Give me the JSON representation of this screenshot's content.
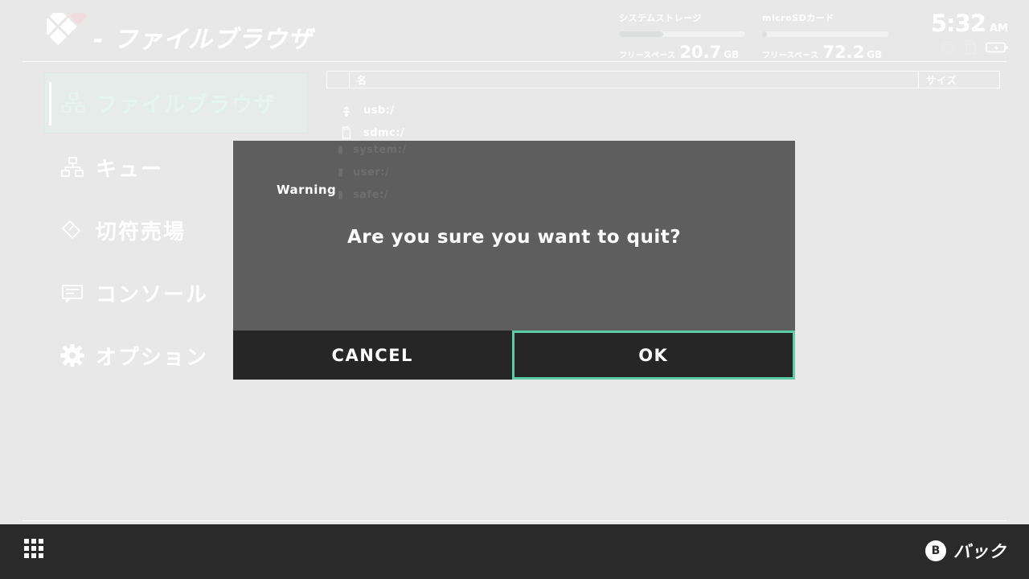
{
  "header": {
    "title": "- ファイルブラウザ",
    "logo_icon": "diamond-logo-icon",
    "storage": [
      {
        "name": "システムストレージ",
        "free_label": "フリースペース",
        "free_value": "20.7",
        "unit": "GB",
        "fill_percent": 35
      },
      {
        "name": "microSDカード",
        "free_label": "フリースペース",
        "free_value": "72.2",
        "unit": "GB",
        "fill_percent": 4
      }
    ],
    "clock": {
      "time": "5:32",
      "meridiem": "AM"
    },
    "tray_icons": [
      "wifi-icon",
      "sd-card-icon",
      "battery-charging-icon"
    ]
  },
  "sidebar": {
    "items": [
      {
        "label": "ファイルブラウザ",
        "icon": "hierarchy-icon",
        "selected": true
      },
      {
        "label": "キュー",
        "icon": "hierarchy-icon",
        "selected": false
      },
      {
        "label": "切符売場",
        "icon": "ticket-icon",
        "selected": false
      },
      {
        "label": "コンソール",
        "icon": "console-icon",
        "selected": false
      },
      {
        "label": "オプション",
        "icon": "gear-icon",
        "selected": false
      }
    ]
  },
  "file_list": {
    "columns": {
      "select": "",
      "name": "名",
      "size": "サイズ"
    },
    "rows": [
      {
        "name": "usb:/",
        "icon": "usb-icon",
        "size": ""
      },
      {
        "name": "sdmc:/",
        "icon": "sd-card-icon",
        "size": ""
      }
    ],
    "obscured_rows": [
      {
        "name": "system:/",
        "icon": "drive-icon"
      },
      {
        "name": "user:/",
        "icon": "drive-icon"
      },
      {
        "name": "safe:/",
        "icon": "drive-icon"
      }
    ]
  },
  "dialog": {
    "title": "Warning",
    "message": "Are you sure you want to quit?",
    "buttons": [
      {
        "label": "CANCEL",
        "focused": false
      },
      {
        "label": "OK",
        "focused": true
      }
    ],
    "focus_color": "#5ecca8",
    "body_color": "#5e5e5e",
    "button_color": "#262626"
  },
  "footer": {
    "grid_icon": "app-grid-icon",
    "back": {
      "button": "B",
      "label": "バック"
    }
  }
}
